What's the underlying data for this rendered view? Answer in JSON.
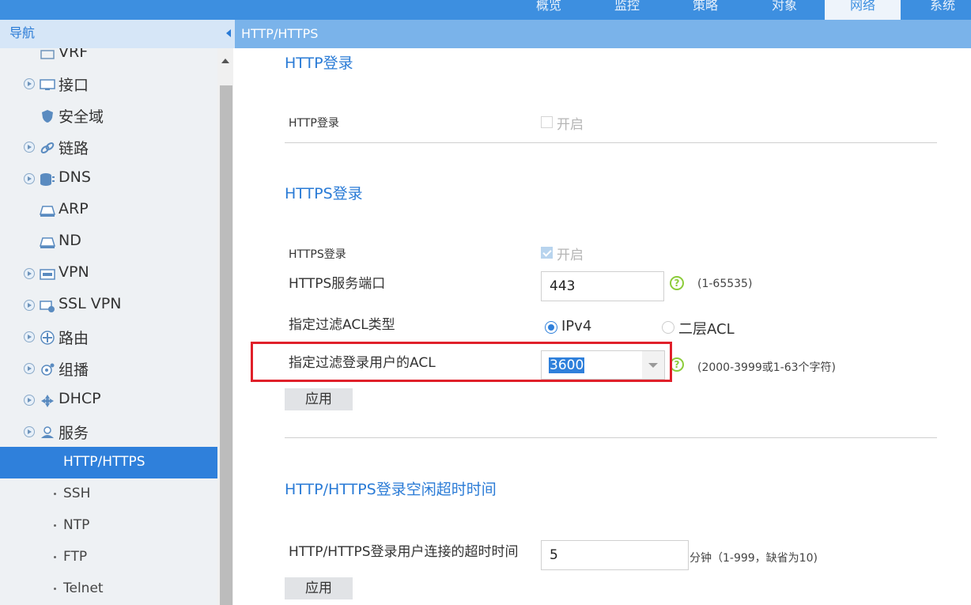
{
  "top_tabs": [
    "概览",
    "监控",
    "策略",
    "对象",
    "网络",
    "系统"
  ],
  "active_tab": "网络",
  "nav_header": "导航",
  "page_header": "HTTP/HTTPS",
  "sidebar": {
    "partial_item": "VRF",
    "items": [
      {
        "label": "接口",
        "icon": "interface-icon",
        "expandable": true
      },
      {
        "label": "安全域",
        "icon": "shield-icon",
        "expandable": false
      },
      {
        "label": "链路",
        "icon": "link-icon",
        "expandable": true
      },
      {
        "label": "DNS",
        "icon": "database-icon",
        "expandable": true
      },
      {
        "label": "ARP",
        "icon": "arp-icon",
        "expandable": false
      },
      {
        "label": "ND",
        "icon": "nd-icon",
        "expandable": false
      },
      {
        "label": "VPN",
        "icon": "vpn-icon",
        "expandable": true
      },
      {
        "label": "SSL VPN",
        "icon": "sslvpn-icon",
        "expandable": true
      },
      {
        "label": "路由",
        "icon": "route-icon",
        "expandable": true
      },
      {
        "label": "组播",
        "icon": "multicast-icon",
        "expandable": true
      },
      {
        "label": "DHCP",
        "icon": "dhcp-icon",
        "expandable": true
      },
      {
        "label": "服务",
        "icon": "service-icon",
        "expandable": true,
        "expanded": true
      }
    ],
    "sub_items": [
      "HTTP/HTTPS",
      "SSH",
      "NTP",
      "FTP",
      "Telnet"
    ],
    "active_sub": "HTTP/HTTPS"
  },
  "http_section": {
    "title": "HTTP登录",
    "label": "HTTP登录",
    "checkbox_text": "开启",
    "checked": false
  },
  "https_section": {
    "title": "HTTPS登录",
    "label": "HTTPS登录",
    "checkbox_text": "开启",
    "checked": true,
    "port_label": "HTTPS服务端口",
    "port_value": "443",
    "port_hint": "(1-65535)",
    "acl_type_label": "指定过滤ACL类型",
    "acl_type_options": [
      "IPv4",
      "二层ACL"
    ],
    "acl_type_selected": "IPv4",
    "acl_label": "指定过滤登录用户的ACL",
    "acl_value": "3600",
    "acl_hint": "(2000-3999或1-63个字符)",
    "apply": "应用"
  },
  "timeout_section": {
    "title": "HTTP/HTTPS登录空闲超时时间",
    "label": "HTTP/HTTPS登录用户连接的超时时间",
    "value": "5",
    "hint": "分钟（1-999，缺省为10)",
    "apply": "应用"
  },
  "colors": {
    "accent": "#2f80db",
    "topbar": "#3d8fe0",
    "highlight": "#e0202a",
    "help": "#8ccc3a"
  }
}
